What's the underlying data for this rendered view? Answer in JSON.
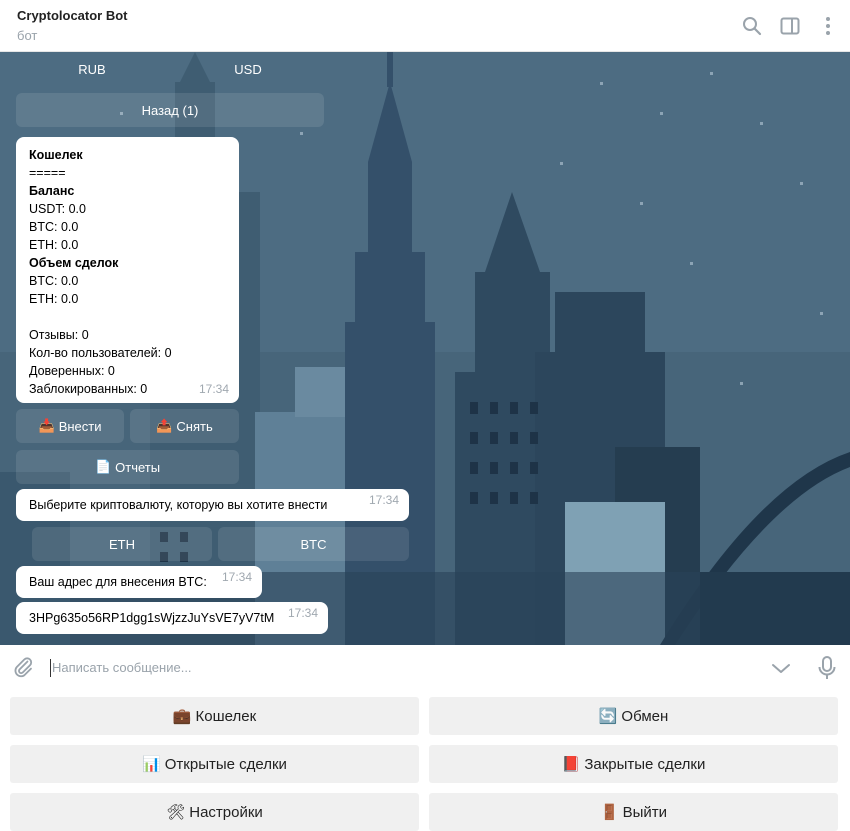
{
  "header": {
    "title": "Cryptolocator Bot",
    "subtitle": "бот",
    "icons": [
      "search-icon",
      "sidebar-toggle-icon",
      "more-vertical-icon"
    ]
  },
  "chat": {
    "top_keyboard": {
      "rub": "RUB",
      "usd": "USD",
      "back": "Назад (1)"
    },
    "wallet_message": {
      "title": "Кошелек",
      "divider": "=====",
      "balance_label": "Баланс",
      "usdt": "USDT: 0.0",
      "btc": "BTC: 0.0",
      "eth": "ETH: 0.0",
      "volume_label": "Объем сделок",
      "vol_btc": "BTC: 0.0",
      "vol_eth": "ETH: 0.0",
      "reviews": "Отзывы: 0",
      "users": "Кол-во пользователей: 0",
      "trusted": "Доверенных: 0",
      "blocked": "Заблокированных: 0",
      "time": "17:34"
    },
    "wallet_keyboard": {
      "deposit": "Внести",
      "withdraw": "Снять",
      "reports": "Отчеты"
    },
    "choose_message": {
      "text": "Выберите криптовалюту, которую вы хотите внести",
      "time": "17:34"
    },
    "currency_keyboard": {
      "eth": "ETH",
      "btc": "BTC"
    },
    "address_message": {
      "text": "Ваш адрес для внесения BTC:",
      "time": "17:34"
    },
    "address_value": {
      "text": "3HPg635o56RP1dgg1sWjzzJuYsVE7yV7tM",
      "time": "17:34"
    }
  },
  "composer": {
    "placeholder": "Написать сообщение...",
    "icons": [
      "attach-icon",
      "chevron-down-icon",
      "microphone-icon"
    ]
  },
  "reply_keyboard": {
    "wallet": {
      "emoji": "💼",
      "label": "Кошелек"
    },
    "exchange": {
      "emoji": "🔄",
      "label": "Обмен"
    },
    "open_deals": {
      "emoji": "📊",
      "label": "Открытые сделки"
    },
    "closed_deals": {
      "emoji": "📕",
      "label": "Закрытые сделки"
    },
    "settings": {
      "emoji": "🛠",
      "label": "Настройки"
    },
    "exit": {
      "emoji": "🚪",
      "label": "Выйти"
    }
  }
}
